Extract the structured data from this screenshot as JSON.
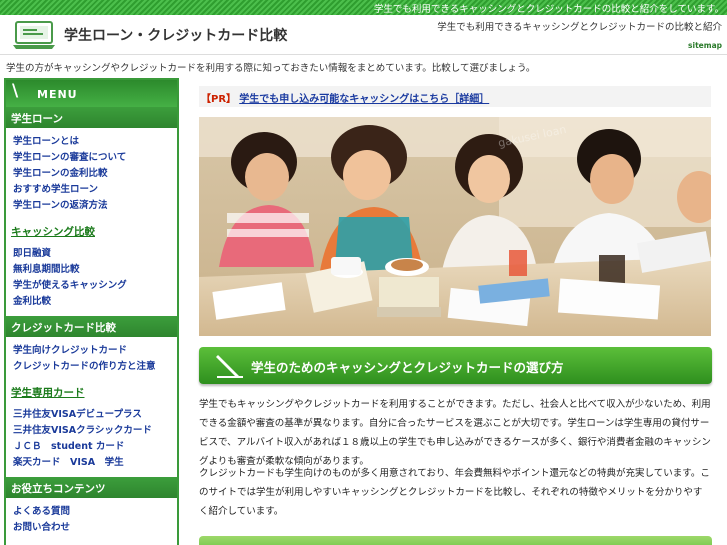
{
  "topbar": {
    "tagline": "学生でも利用できるキャッシングとクレジットカードの比較と紹介をしています。"
  },
  "header": {
    "site_title": "学生ローン・クレジットカード比較",
    "subtitle": "学生でも利用できるキャッシングとクレジットカードの比較と紹介",
    "sitemap": "sitemap",
    "logo_icon": "laptop-icon"
  },
  "intro": "学生の方がキャッシングやクレジットカードを利用する際に知っておきたい情報をまとめています。比較して選びましょう。",
  "sidebar": {
    "menu_label": "MENU",
    "sections": [
      {
        "title": "学生ローン",
        "style": "dark",
        "links": [
          "学生ローンとは",
          "学生ローンの審査について",
          "学生ローンの金利比較",
          "おすすめ学生ローン",
          "学生ローンの返済方法"
        ]
      },
      {
        "title": "キャッシング比較",
        "style": "light",
        "links": [
          "即日融資",
          "無利息期間比較",
          "学生が使えるキャッシング",
          "金利比較"
        ]
      },
      {
        "title": "クレジットカード比較",
        "style": "dark",
        "links": [
          "学生向けクレジットカード",
          "クレジットカードの作り方と注意"
        ]
      },
      {
        "title": "学生専用カード",
        "style": "light",
        "links": [
          "三井住友VISAデビュープラス",
          "三井住友VISAクラシックカード",
          "ＪＣＢ　student カード",
          "楽天カード　VISA　学生"
        ]
      },
      {
        "title": "お役立ちコンテンツ",
        "style": "dark",
        "links": [
          "よくある質問",
          "お問い合わせ"
        ]
      }
    ]
  },
  "pr": {
    "tag": "【PR】",
    "link": "学生でも申し込み可能なキャッシングはこちら［詳細］"
  },
  "main": {
    "photo_alt": "students-studying-photo",
    "heading": "学生のためのキャッシングとクレジットカードの選び方",
    "paragraphs": [
      "学生でもキャッシングやクレジットカードを利用することができます。ただし、社会人と比べて収入が少ないため、利用できる金額や審査の基準が異なります。自分に合ったサービスを選ぶことが大切です。学生ローンは学生専用の貸付サービスで、アルバイト収入があれば１８歳以上の学生でも申し込みができるケースが多く、銀行や消費者金融のキャッシングよりも審査が柔軟な傾向があります。",
      "クレジットカードも学生向けのものが多く用意されており、年会費無料やポイント還元などの特典が充実しています。このサイトでは学生が利用しやすいキャッシングとクレジットカードを比較し、それぞれの特徴やメリットを分かりやすく紹介しています。"
    ]
  },
  "colors": {
    "accent": "#3a9a3a",
    "link": "#1a3a9a",
    "pr": "#cc2200"
  }
}
